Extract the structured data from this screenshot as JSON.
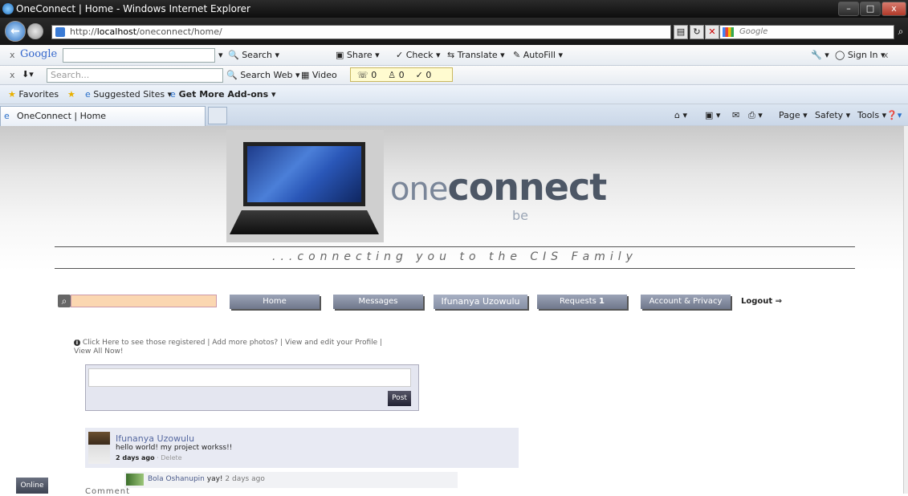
{
  "window": {
    "title": "OneConnect | Home - Windows Internet Explorer",
    "min": "–",
    "max": "□",
    "close": "x"
  },
  "nav": {
    "url_prefix": "http://",
    "url_host": "localhost",
    "url_path": "/oneconnect/home/",
    "search_placeholder": "Google"
  },
  "google_toolbar": {
    "close": "x",
    "brand": "Google",
    "search": "Search",
    "share": "Share",
    "check": "Check",
    "translate": "Translate",
    "autofill": "AutoFill",
    "sign_in": "Sign In",
    "close_right": "x"
  },
  "search_toolbar": {
    "close": "x",
    "placeholder": "Search...",
    "search_web": "Search Web",
    "video": "Video",
    "count1": "0",
    "count2": "0",
    "count3": "0"
  },
  "favorites_bar": {
    "favorites": "Favorites",
    "suggested": "Suggested Sites",
    "addons": "Get More Add-ons"
  },
  "tabs": {
    "active": "OneConnect | Home",
    "page": "Page",
    "safety": "Safety",
    "tools": "Tools"
  },
  "site": {
    "logo_one": "one",
    "logo_connect": "connect",
    "logo_sub": "be",
    "tagline": "...connecting you to the CIS Family",
    "menu": {
      "home": "Home",
      "messages": "Messages",
      "user": "Ifunanya Uzowulu",
      "requests": "Requests",
      "requests_count": "1",
      "account": "Account & Privacy",
      "logout": "Logout ⇒"
    },
    "info": {
      "registered": "Click Here to see those registered",
      "photos": "Add more photos?",
      "profile": "View and edit your Profile",
      "view_all": "View All Now!",
      "sep": "|"
    },
    "post_button": "Post",
    "feed": {
      "name": "Ifunanya Uzowulu",
      "message": "hello world! my project workss!!",
      "time": "2 days ago",
      "delete": "Delete",
      "sep": "·"
    },
    "comment": {
      "name": "Bola Oshanupin",
      "text": "yay!",
      "time": "2 days ago"
    },
    "comment_label": "Comment",
    "online": "Online"
  }
}
